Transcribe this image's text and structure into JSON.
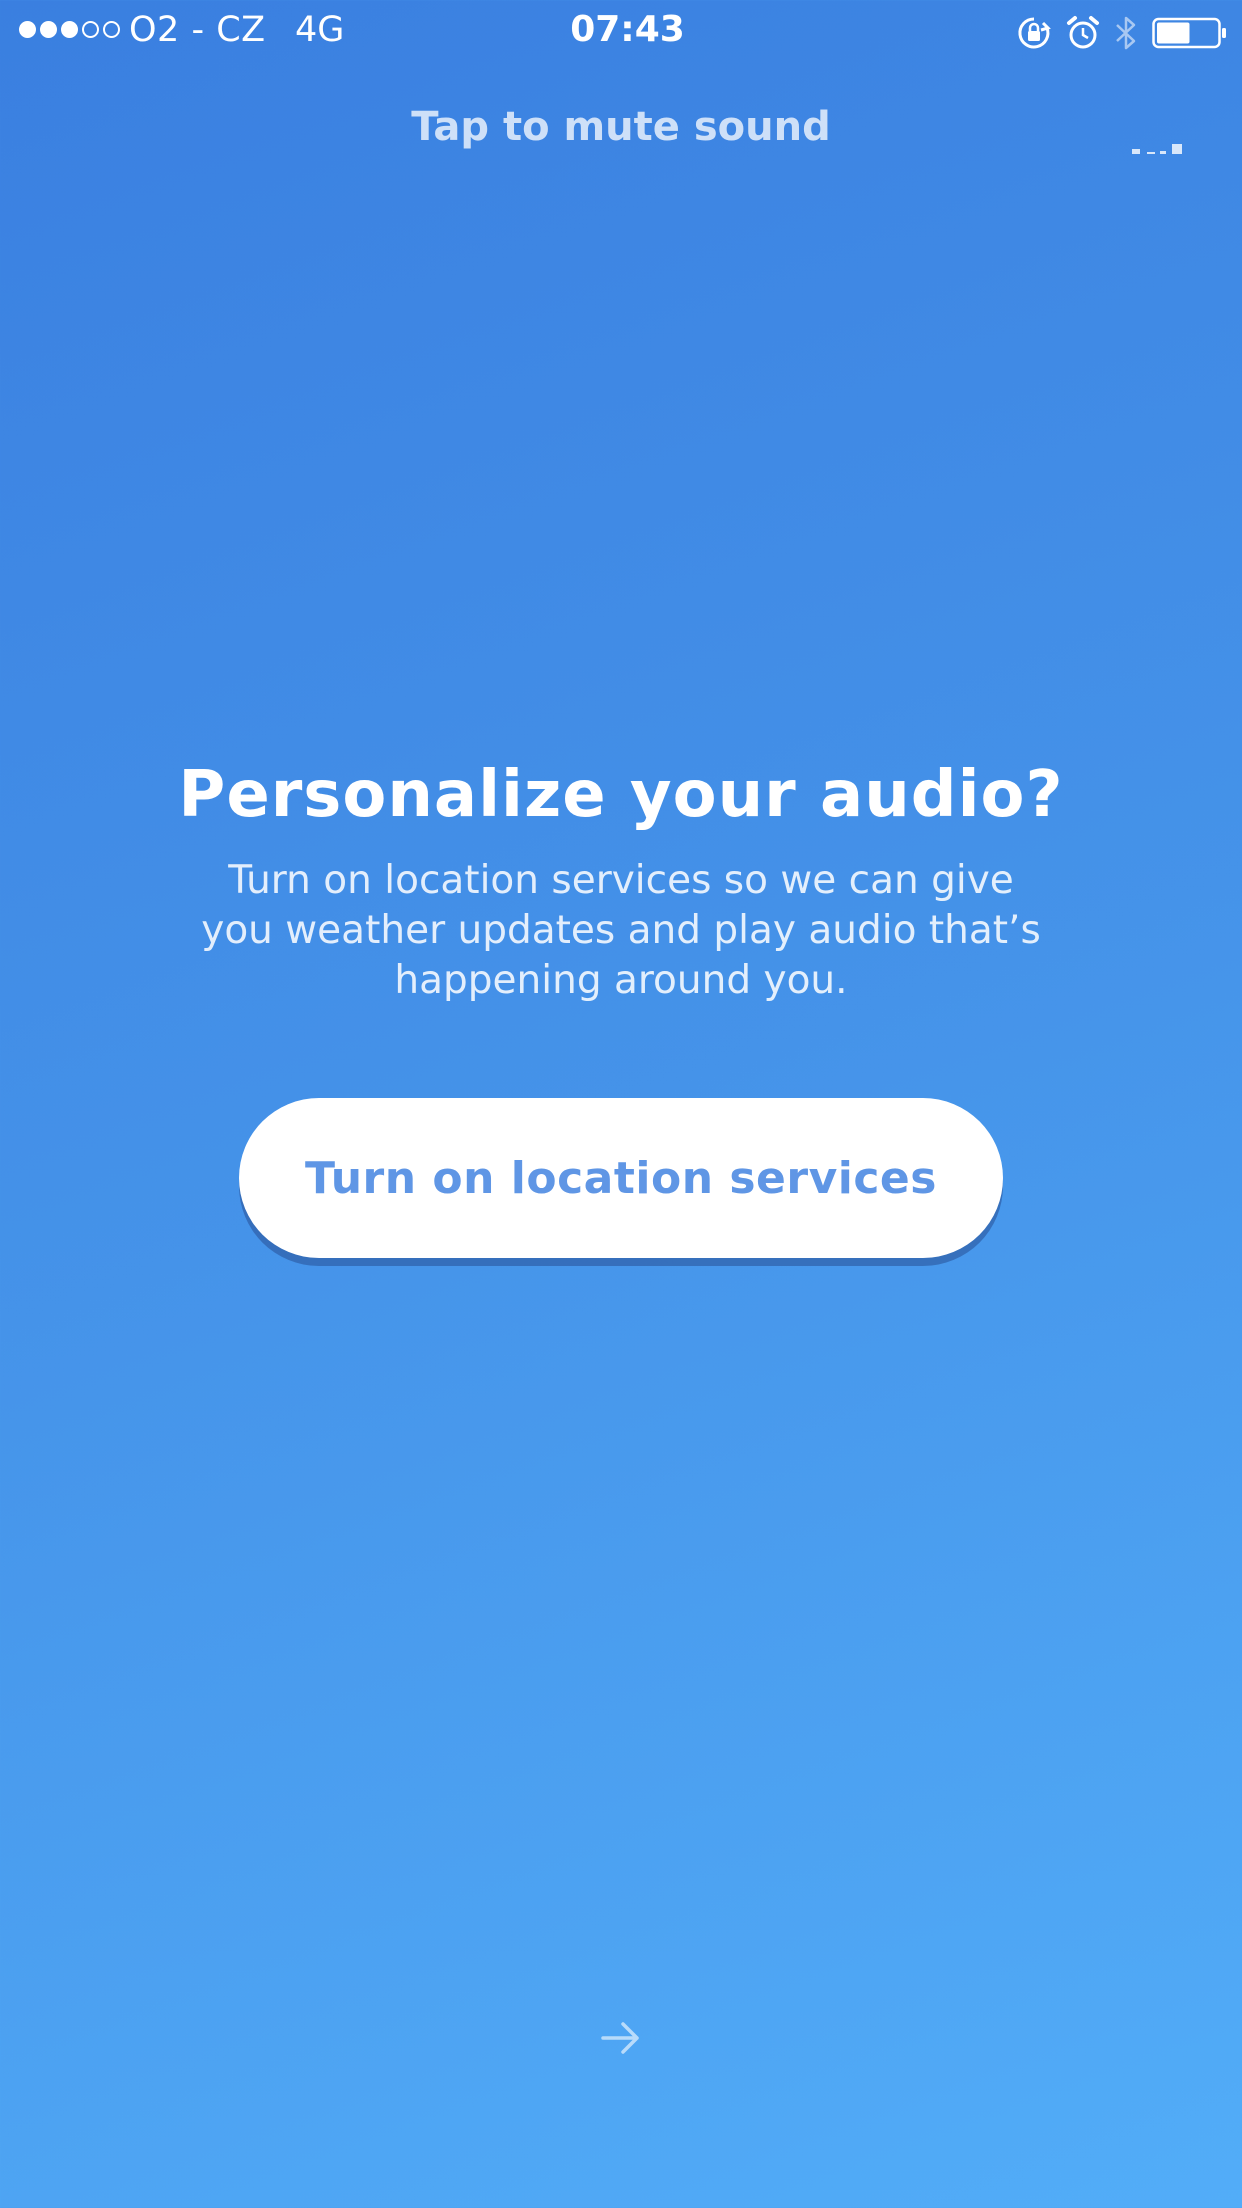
{
  "status_bar": {
    "signal_strength": 3,
    "signal_max": 5,
    "carrier": "O2 - CZ",
    "network": "4G",
    "time": "07:43",
    "icons": [
      "rotation-lock-icon",
      "alarm-icon",
      "bluetooth-icon",
      "battery-icon"
    ],
    "battery_level": 0.55
  },
  "header": {
    "mute_label": "Tap to mute sound",
    "equalizer_icon": "equalizer-icon"
  },
  "main": {
    "heading": "Personalize your audio?",
    "body_lines": [
      "Turn on location services so we can give",
      "you weather updates and play audio that’s",
      "happening around you."
    ],
    "cta_label": "Turn on location services"
  },
  "footer": {
    "next_icon": "arrow-right-icon"
  },
  "colors": {
    "gradient_start": "#3a7fe0",
    "gradient_end": "#52adf8",
    "button_bg": "#ffffff",
    "button_text": "#5f96e5"
  }
}
